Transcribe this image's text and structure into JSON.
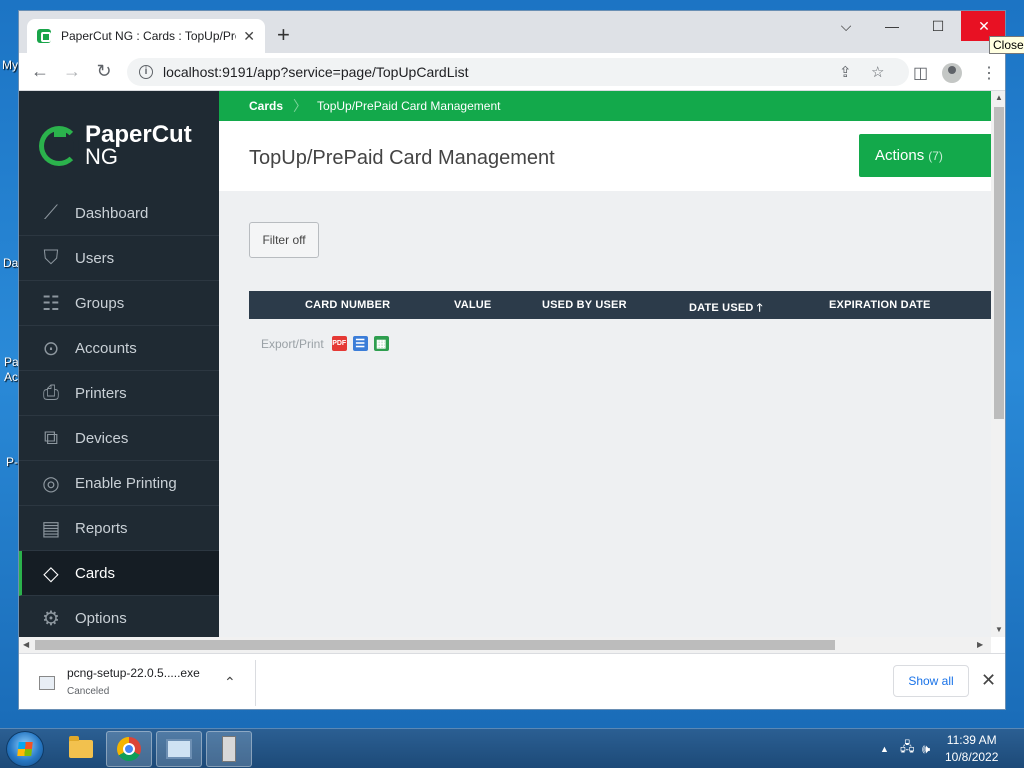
{
  "browser": {
    "tab_title": "PaperCut NG : Cards : TopUp/PrePaid Card Management",
    "url": "localhost:9191/app?service=page/TopUpCardList",
    "close_tooltip": "Close"
  },
  "desktop": {
    "icon_labels": [
      "My",
      "Da",
      "Pa",
      "Ac",
      "P-"
    ]
  },
  "logo": {
    "line1": "PaperCut",
    "line2": "NG"
  },
  "sidebar": {
    "items": [
      {
        "label": "Dashboard",
        "icon": "chart-line-icon",
        "glyph": "⟋"
      },
      {
        "label": "Users",
        "icon": "shield-user-icon",
        "glyph": "⛉"
      },
      {
        "label": "Groups",
        "icon": "groups-icon",
        "glyph": "☷"
      },
      {
        "label": "Accounts",
        "icon": "accounts-icon",
        "glyph": "⊙"
      },
      {
        "label": "Printers",
        "icon": "printer-icon",
        "glyph": "⎙"
      },
      {
        "label": "Devices",
        "icon": "devices-icon",
        "glyph": "⧉"
      },
      {
        "label": "Enable Printing",
        "icon": "enable-printing-icon",
        "glyph": "◎"
      },
      {
        "label": "Reports",
        "icon": "reports-icon",
        "glyph": "▤"
      },
      {
        "label": "Cards",
        "icon": "cards-icon",
        "glyph": "◇"
      },
      {
        "label": "Options",
        "icon": "gear-icon",
        "glyph": "⚙"
      }
    ],
    "active": "Cards"
  },
  "breadcrumb": {
    "root": "Cards",
    "current": "TopUp/PrePaid Card Management"
  },
  "header": {
    "title": "TopUp/PrePaid Card Management",
    "actions_label": "Actions",
    "actions_count": "(7)"
  },
  "filter": {
    "label": "Filter off"
  },
  "table": {
    "columns": [
      "CARD NUMBER",
      "VALUE",
      "USED BY USER",
      "DATE USED 🡑",
      "EXPIRATION DATE"
    ]
  },
  "export": {
    "label": "Export/Print",
    "pdf_label": "PDF"
  },
  "downloads": {
    "filename": "pcng-setup-22.0.5.....exe",
    "status": "Canceled",
    "show_all": "Show all"
  },
  "taskbar": {
    "time": "11:39 AM",
    "date": "10/8/2022"
  },
  "colors": {
    "brand_green": "#13a94b",
    "sidebar_bg": "#1f2a33",
    "table_header": "#2c3b4a"
  }
}
